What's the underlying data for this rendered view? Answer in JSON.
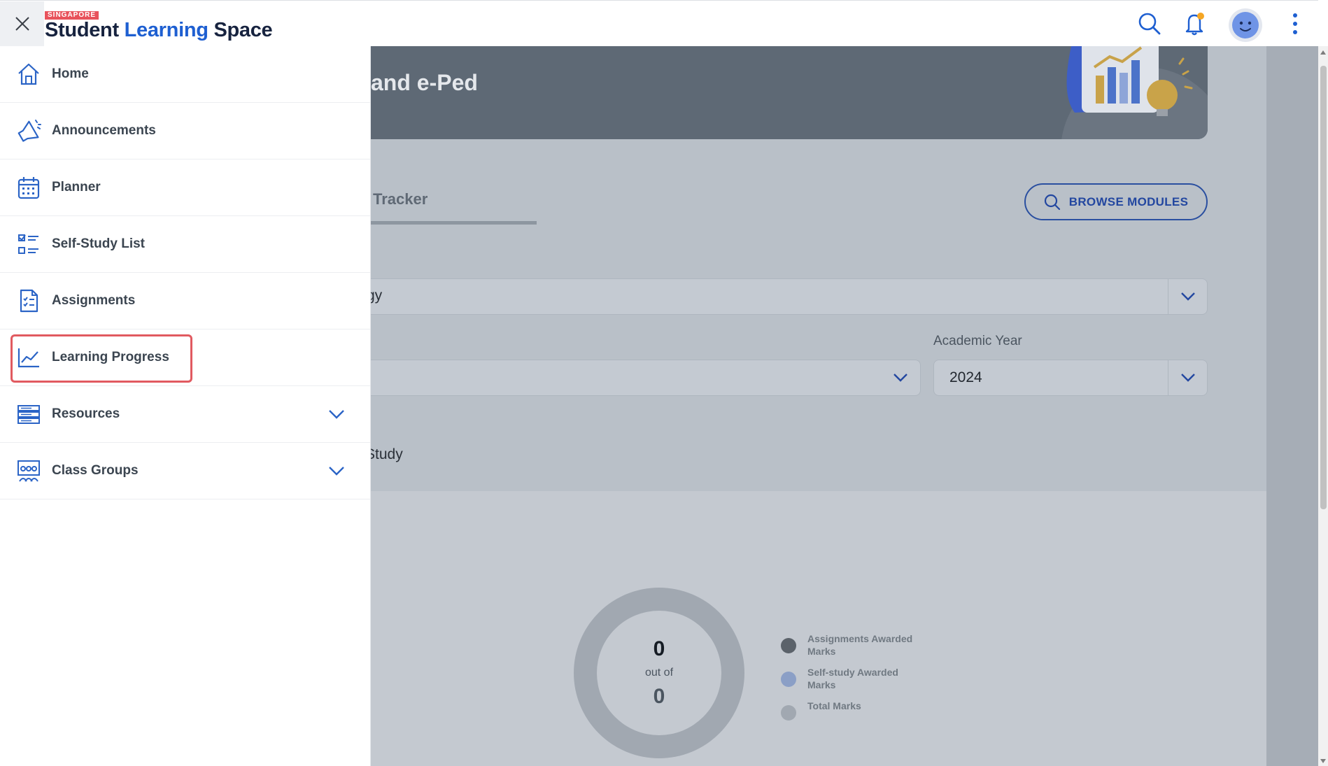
{
  "header": {
    "logo_tag": "SINGAPORE",
    "logo_word1": "Student",
    "logo_word2": "Learning",
    "logo_word3": "Space",
    "accent": "#1e5fd1",
    "notification_dot": "#f5a623"
  },
  "sidebar": {
    "items": [
      {
        "label": "Home",
        "icon": "home-icon"
      },
      {
        "label": "Announcements",
        "icon": "megaphone-icon"
      },
      {
        "label": "Planner",
        "icon": "calendar-icon"
      },
      {
        "label": "Self-Study List",
        "icon": "checklist-icon"
      },
      {
        "label": "Assignments",
        "icon": "assignment-icon"
      },
      {
        "label": "Learning Progress",
        "icon": "line-chart-icon",
        "highlighted": true
      },
      {
        "label": "Resources",
        "icon": "resources-icon",
        "expandable": true
      },
      {
        "label": "Class Groups",
        "icon": "class-groups-icon",
        "expandable": true
      }
    ],
    "highlight_color": "#e15a60"
  },
  "main": {
    "banner_title": "and e-Ped",
    "tab_label": "Tracker",
    "browse_label": "BROWSE MODULES",
    "filter_value": "gy",
    "academic_year_label": "Academic Year",
    "academic_year_value": "2024",
    "study_label": "Study",
    "progress": {
      "awarded": "0",
      "out_of_label": "out of",
      "total": "0"
    },
    "legend": [
      {
        "label": "Assignments Awarded Marks",
        "color": "#5b626a"
      },
      {
        "label": "Self-study Awarded Marks",
        "color": "#8b9fc6"
      },
      {
        "label": "Total Marks",
        "color": "#a1a8b1"
      }
    ]
  }
}
